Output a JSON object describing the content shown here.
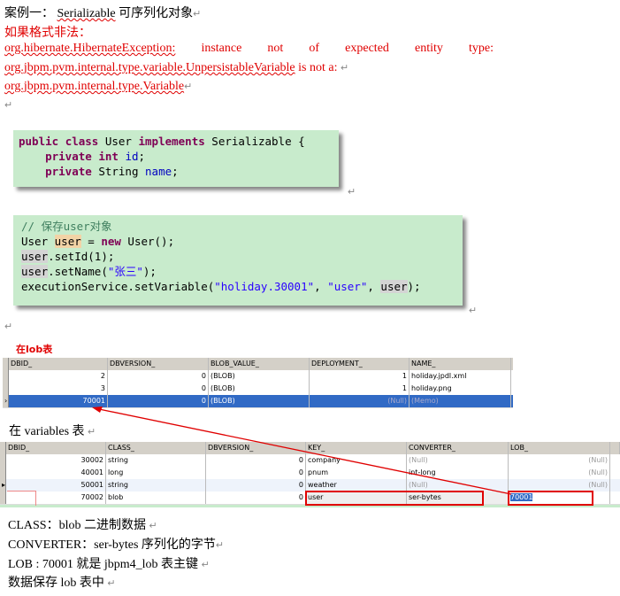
{
  "heading": {
    "prefix": "案例一：",
    "keyword": "Serializable",
    "suffix": "可序列化对象"
  },
  "error": {
    "label": "如果格式非法：",
    "line1": [
      "org.hibernate.HibernateException:",
      "instance",
      "not",
      "of",
      "expected",
      "entity",
      "type:"
    ],
    "line2_class": "org.jbpm.pvm.internal.type.variable.UnpersistableVariable",
    "line2_rest": "is not a:",
    "line3": "org.jbpm.pvm.internal.type.Variable"
  },
  "code1": {
    "l1": [
      "public",
      "class",
      "User",
      "implements",
      "Serializable {"
    ],
    "l2": [
      "private",
      "int",
      "id",
      ";"
    ],
    "l3": [
      "private",
      "String",
      "name",
      ";"
    ]
  },
  "code2": {
    "comment": "// 保存user对象",
    "l1": [
      "User ",
      "user",
      " = ",
      "new",
      " User();"
    ],
    "l2": [
      "user",
      ".setId(1);"
    ],
    "l3": [
      "user",
      ".setName(",
      "\"张三\"",
      ");"
    ],
    "l4": [
      "executionService.setVariable(",
      "\"holiday.30001\"",
      ", ",
      "\"user\"",
      ", ",
      "user",
      ");"
    ]
  },
  "lob_label": "在lob表",
  "lob_table": {
    "headers": [
      "DBID_",
      "DBVERSION_",
      "BLOB_VALUE_",
      "DEPLOYMENT_",
      "NAME_"
    ],
    "rows": [
      [
        "2",
        "0",
        "(BLOB)",
        "1",
        "holiday.jpdl.xml"
      ],
      [
        "3",
        "0",
        "(BLOB)",
        "1",
        "holiday.png"
      ],
      [
        "70001",
        "0",
        "(BLOB)",
        "(Null)",
        "(Memo)"
      ]
    ]
  },
  "variables_label": "在  variables  表",
  "var_table": {
    "headers": [
      "DBID_",
      "CLASS_",
      "DBVERSION_",
      "KEY_",
      "CONVERTER_",
      "LOB_"
    ],
    "rows": [
      [
        "30002",
        "string",
        "0",
        "company",
        "(Null)",
        "(Null)"
      ],
      [
        "40001",
        "long",
        "0",
        "pnum",
        "int-long",
        "(Null)"
      ],
      [
        "50001",
        "string",
        "0",
        "weather",
        "(Null)",
        "(Null)"
      ],
      [
        "70002",
        "blob",
        "0",
        "user",
        "ser-bytes",
        "70001"
      ]
    ]
  },
  "notes": [
    "CLASS：blob  二进制数据",
    "CONVERTER：ser-bytes  序列化的字节",
    "LOB : 70001  就是  jbpm4_lob  表主键",
    "数据保存  lob  表中"
  ],
  "colors": {
    "code_bg": "#c8ebcc",
    "error": "#e00000",
    "selection": "#316ac5"
  }
}
